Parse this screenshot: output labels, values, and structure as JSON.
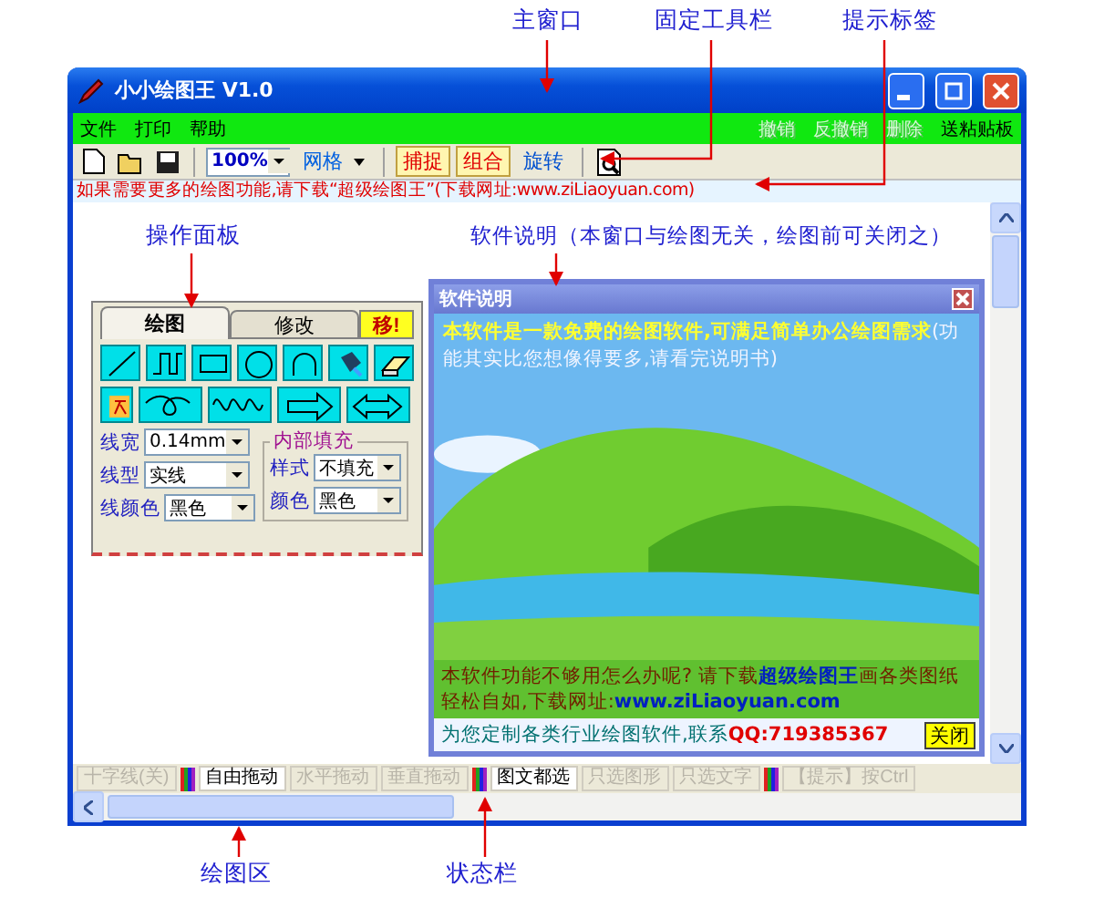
{
  "annotations": [
    {
      "text": "主窗口"
    },
    {
      "text": "固定工具栏"
    },
    {
      "text": "提示标签"
    },
    {
      "text": "操作面板"
    },
    {
      "text": "软件说明（本窗口与绘图无关，绘图前可关闭之）"
    },
    {
      "text": "绘图区"
    },
    {
      "text": "状态栏"
    }
  ],
  "window": {
    "title": "小小绘图王 V1.0"
  },
  "menu": {
    "left": [
      "文件",
      "打印",
      "帮助"
    ],
    "right": [
      {
        "label": "撤销",
        "disabled": true
      },
      {
        "label": "反撤销",
        "disabled": true
      },
      {
        "label": "删除",
        "disabled": true
      },
      {
        "label": "送粘贴板",
        "disabled": false
      }
    ]
  },
  "toolbar": {
    "zoom": "100%",
    "grid": "网格",
    "buttons": [
      {
        "label": "捕捉",
        "on": true
      },
      {
        "label": "组合",
        "on": true
      },
      {
        "label": "旋转",
        "on": false
      }
    ]
  },
  "hint": "如果需要更多的绘图功能,请下载“超级绘图王”(下载网址:www.ziLiaoyuan.com)",
  "panel": {
    "tabs": [
      {
        "label": "绘图",
        "selected": true,
        "kind": "tab"
      },
      {
        "label": "修改",
        "selected": false,
        "kind": "tab"
      },
      {
        "label": "移!",
        "selected": false,
        "kind": "flag"
      }
    ],
    "fields": [
      {
        "label": "线宽",
        "value": "0.14mm"
      },
      {
        "label": "线型",
        "value": "实线"
      },
      {
        "label": "线颜色",
        "value": "黑色"
      }
    ],
    "fill": {
      "title": "内部填充",
      "fields": [
        {
          "label": "样式",
          "value": "不填充"
        },
        {
          "label": "颜色",
          "value": "黑色"
        }
      ]
    }
  },
  "dialog": {
    "title": "软件说明",
    "intro": [
      {
        "text": "本软件是一款免费的绘图软件,可满足简单办公绘图需求",
        "kind": "emphasis"
      },
      {
        "text": "(功能其实比您想像得要多,请看完说明书)",
        "kind": "plain"
      }
    ],
    "promo": [
      {
        "text": "本软件功能不够用怎么办呢? 请下载",
        "kind": "plain"
      },
      {
        "text": "超级绘图王",
        "kind": "emphasis"
      },
      {
        "text": "画各类图纸轻松自如,下载网址:",
        "kind": "plain"
      },
      {
        "text": "www.ziLiaoyuan.com",
        "kind": "emphasis"
      }
    ],
    "footer": [
      {
        "text": "为您定制各类行业绘图软件,联系",
        "kind": "plain"
      },
      {
        "text": "QQ:719385367",
        "kind": "emphasis"
      }
    ],
    "close_button": "关闭"
  },
  "status_bar": {
    "items": [
      {
        "kind": "toggle",
        "label": "十字线(关)",
        "selected": false
      },
      {
        "kind": "swatch"
      },
      {
        "kind": "toggle",
        "label": "自由拖动",
        "selected": true
      },
      {
        "kind": "toggle",
        "label": "水平拖动",
        "selected": false
      },
      {
        "kind": "toggle",
        "label": "垂直拖动",
        "selected": false
      },
      {
        "kind": "swatch"
      },
      {
        "kind": "toggle",
        "label": "图文都选",
        "selected": true
      },
      {
        "kind": "toggle",
        "label": "只选图形",
        "selected": false
      },
      {
        "kind": "toggle",
        "label": "只选文字",
        "selected": false
      },
      {
        "kind": "swatch"
      },
      {
        "kind": "toggle",
        "label": "【提示】按Ctrl",
        "selected": false
      }
    ]
  }
}
